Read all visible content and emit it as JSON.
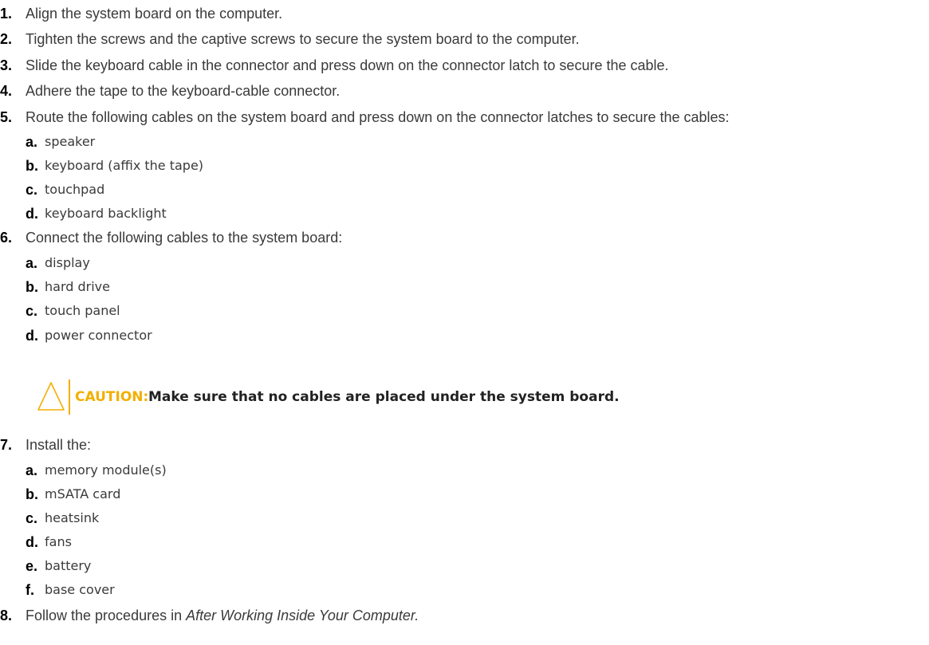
{
  "steps": [
    {
      "num": "1.",
      "text": "Align the system board on the computer."
    },
    {
      "num": "2.",
      "text": "Tighten the screws and the captive screws to secure the system board to the computer."
    },
    {
      "num": "3.",
      "text": "Slide the keyboard cable in the connector and press down on the connector latch to secure the cable."
    },
    {
      "num": "4.",
      "text": "Adhere the tape to the keyboard-cable connector."
    },
    {
      "num": "5.",
      "text": "Route the following cables on the system board and press down on the connector latches to secure the cables:",
      "items": [
        {
          "letter": "a.",
          "text": "speaker"
        },
        {
          "letter": "b.",
          "text": "keyboard (affix the tape)"
        },
        {
          "letter": "c.",
          "text": "touchpad"
        },
        {
          "letter": "d.",
          "text": "keyboard backlight"
        }
      ]
    },
    {
      "num": "6.",
      "text": "Connect the following cables to the system board:",
      "items": [
        {
          "letter": "a.",
          "text": "display"
        },
        {
          "letter": "b.",
          "text": "hard drive"
        },
        {
          "letter": "c.",
          "text": "touch panel"
        },
        {
          "letter": "d.",
          "text": "power connector"
        }
      ]
    },
    {
      "num": "7.",
      "text": "Install the:",
      "items": [
        {
          "letter": "a.",
          "text": "memory module(s)"
        },
        {
          "letter": "b.",
          "text": "mSATA card"
        },
        {
          "letter": "c.",
          "text": "heatsink"
        },
        {
          "letter": "d.",
          "text": "fans"
        },
        {
          "letter": "e.",
          "text": "battery"
        },
        {
          "letter": "f.",
          "text": "base cover"
        }
      ]
    },
    {
      "num": "8.",
      "text_prefix": "Follow the procedures in ",
      "text_italic": "After Working Inside Your Computer."
    }
  ],
  "caution": {
    "label": "CAUTION:",
    "message": "Make sure that no cables are placed under the system board.",
    "color": "#f2af00"
  }
}
